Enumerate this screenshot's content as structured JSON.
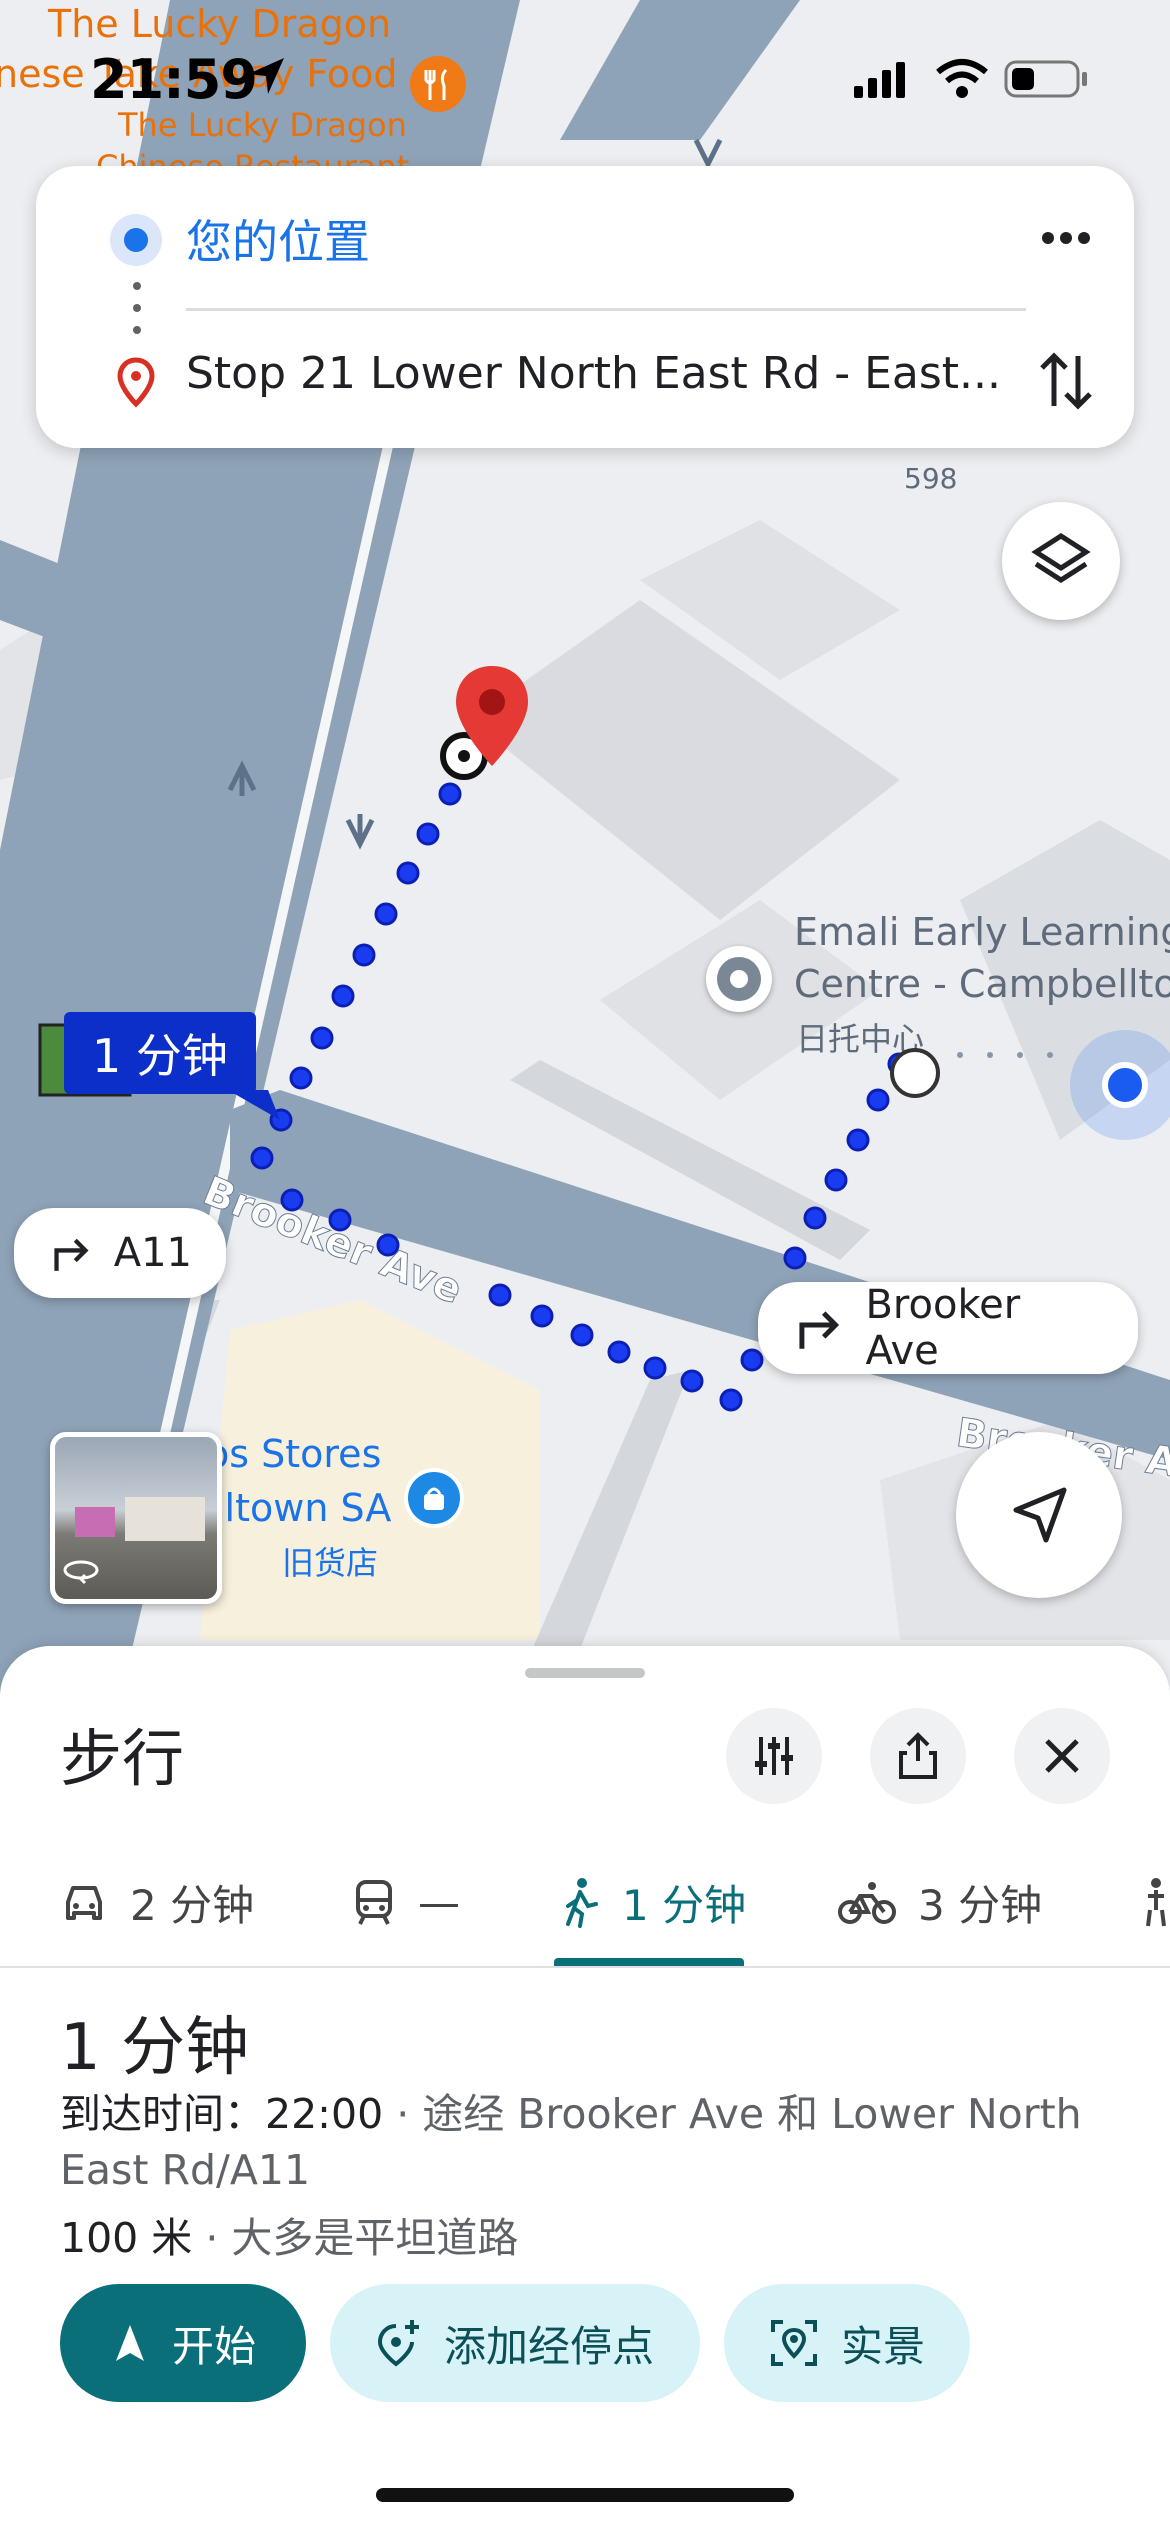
{
  "status_bar": {
    "time": "21:59"
  },
  "directions_card": {
    "origin": "您的位置",
    "destination": "Stop 21 Lower North East Rd - East..."
  },
  "map": {
    "poi_top_1": "The Lucky Dragon",
    "poi_top_2": "nese Take Away Food",
    "poi_top_3": "The Lucky Dragon",
    "poi_top_4": "Chinese Restaurant",
    "house_number": "598",
    "emali_1": "Emali Early Learning",
    "emali_2": "Centre - Campbellto",
    "emali_sub": "日托中心",
    "store_1": "os Stores",
    "store_2": "lltown SA",
    "store_sub": "旧货店",
    "street_brooker": "Brooker Ave",
    "street_brooker_right": "Brooker Ave",
    "duration_bubble": "1 分钟",
    "chip_a11": "A11",
    "chip_brooker": "Brooker Ave"
  },
  "sheet": {
    "title": "步行",
    "modes": [
      {
        "label": "2 分钟",
        "icon": "car-icon"
      },
      {
        "label": "—",
        "icon": "transit-icon"
      },
      {
        "label": "1 分钟",
        "icon": "walk-icon"
      },
      {
        "label": "3 分钟",
        "icon": "bike-icon"
      }
    ],
    "duration": "1 分钟",
    "arrival_label": "到达时间：22:00",
    "via_text": " · 途经 Brooker Ave 和 Lower North East Rd/A11",
    "distance": "100 米",
    "terrain": " · 大多是平坦道路",
    "start_label": "开始",
    "add_stop_label": "添加经停点",
    "live_view_label": "实景"
  },
  "colors": {
    "accent": "#0b6f7a",
    "route_blue": "#1a3cf0",
    "pin_red": "#e53935",
    "road_blue": "#8fa3b8"
  }
}
